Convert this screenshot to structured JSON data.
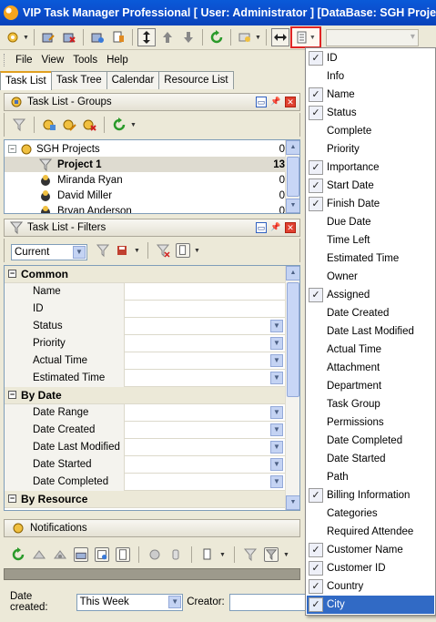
{
  "window": {
    "title": "VIP Task Manager Professional [ User: Administrator ] [DataBase: SGH Proje"
  },
  "menubar": {
    "items": [
      "File",
      "View",
      "Tools",
      "Help"
    ]
  },
  "tabs": [
    {
      "label": "Task List",
      "active": true
    },
    {
      "label": "Task Tree",
      "active": false
    },
    {
      "label": "Calendar",
      "active": false
    },
    {
      "label": "Resource List",
      "active": false
    }
  ],
  "groups_panel": {
    "title": "Task List - Groups",
    "tree": [
      {
        "label": "SGH Projects",
        "count": "0"
      },
      {
        "label": "Project 1",
        "count": "13"
      },
      {
        "label": "Miranda Ryan",
        "count": "0"
      },
      {
        "label": "David Miller",
        "count": "0"
      },
      {
        "label": "Bryan Anderson",
        "count": "0"
      }
    ]
  },
  "filters_panel": {
    "title": "Task List - Filters",
    "combo_value": "Current",
    "rows": [
      {
        "label": "Common",
        "category": true
      },
      {
        "label": "Name",
        "category": false,
        "dropdown": false
      },
      {
        "label": "ID",
        "category": false,
        "dropdown": false
      },
      {
        "label": "Status",
        "category": false,
        "dropdown": true
      },
      {
        "label": "Priority",
        "category": false,
        "dropdown": true
      },
      {
        "label": "Actual Time",
        "category": false,
        "dropdown": true
      },
      {
        "label": "Estimated Time",
        "category": false,
        "dropdown": true
      },
      {
        "label": "By Date",
        "category": true
      },
      {
        "label": "Date Range",
        "category": false,
        "dropdown": true
      },
      {
        "label": "Date Created",
        "category": false,
        "dropdown": true
      },
      {
        "label": "Date Last Modified",
        "category": false,
        "dropdown": true
      },
      {
        "label": "Date Started",
        "category": false,
        "dropdown": true
      },
      {
        "label": "Date Completed",
        "category": false,
        "dropdown": true
      },
      {
        "label": "By Resource",
        "category": true
      }
    ]
  },
  "notifications": {
    "title": "Notifications",
    "date_created_label": "Date created:",
    "date_created_value": "This Week",
    "creator_label": "Creator:"
  },
  "columns_menu": {
    "items": [
      {
        "label": "ID",
        "checked": true
      },
      {
        "label": "Info",
        "checked": false
      },
      {
        "label": "Name",
        "checked": true
      },
      {
        "label": "Status",
        "checked": true
      },
      {
        "label": "Complete",
        "checked": false
      },
      {
        "label": "Priority",
        "checked": false
      },
      {
        "label": "Importance",
        "checked": true
      },
      {
        "label": "Start Date",
        "checked": true
      },
      {
        "label": "Finish Date",
        "checked": true
      },
      {
        "label": "Due Date",
        "checked": false
      },
      {
        "label": "Time Left",
        "checked": false
      },
      {
        "label": "Estimated Time",
        "checked": false
      },
      {
        "label": "Owner",
        "checked": false
      },
      {
        "label": "Assigned",
        "checked": true
      },
      {
        "label": "Date Created",
        "checked": false
      },
      {
        "label": "Date Last Modified",
        "checked": false
      },
      {
        "label": "Actual Time",
        "checked": false
      },
      {
        "label": "Attachment",
        "checked": false
      },
      {
        "label": "Department",
        "checked": false
      },
      {
        "label": "Task Group",
        "checked": false
      },
      {
        "label": "Permissions",
        "checked": false
      },
      {
        "label": "Date Completed",
        "checked": false
      },
      {
        "label": "Date Started",
        "checked": false
      },
      {
        "label": "Path",
        "checked": false
      },
      {
        "label": "Billing Information",
        "checked": true
      },
      {
        "label": "Categories",
        "checked": false
      },
      {
        "label": "Required Attendee",
        "checked": false
      },
      {
        "label": "Customer Name",
        "checked": true
      },
      {
        "label": "Customer ID",
        "checked": true
      },
      {
        "label": "Country",
        "checked": true
      },
      {
        "label": "City",
        "checked": true,
        "highlighted": true
      }
    ]
  },
  "colors": {
    "title_bar": "#0b4fcf",
    "menu_highlight": "#316ac5",
    "callout": "#e02424"
  }
}
